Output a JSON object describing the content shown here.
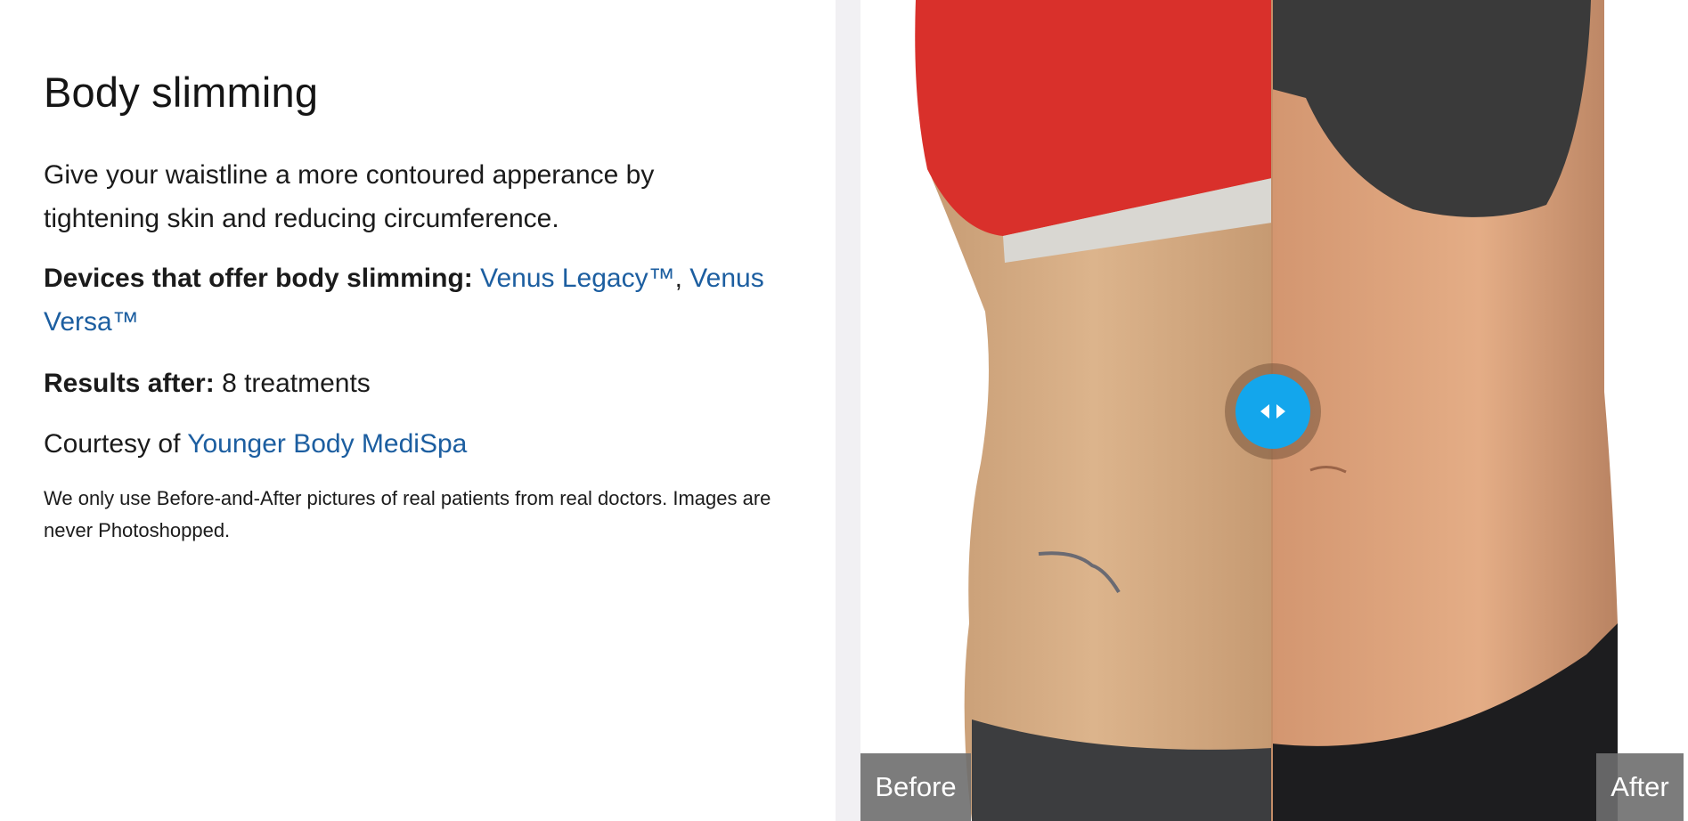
{
  "content": {
    "title": "Body slimming",
    "description": "Give your waistline a more contoured apperance by tightening skin and reducing circumference.",
    "devices_label": "Devices that offer body slimming:",
    "devices": [
      {
        "label": "Venus Legacy™"
      },
      {
        "label": "Venus Versa™"
      }
    ],
    "devices_separator": ",",
    "results_label": "Results after:",
    "results_value": "8 treatments",
    "courtesy_prefix": "Courtesy of",
    "courtesy_link": "Younger Body MediSpa",
    "disclaimer": "We only use Before-and-After pictures of real patients from real doctors. Images are never Photoshopped."
  },
  "comparison": {
    "before_label": "Before",
    "after_label": "After",
    "handle_icon": "left-right-arrows-icon",
    "slider_position_fraction": 0.5
  },
  "colors": {
    "link": "#1c5ea0",
    "handle": "#13a6ec",
    "label_bg": "#6e6e6e"
  }
}
